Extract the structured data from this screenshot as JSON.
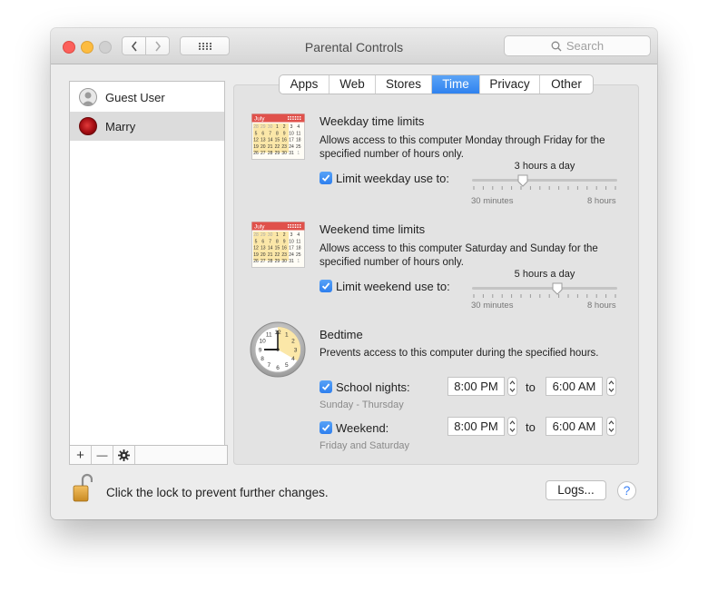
{
  "window": {
    "title": "Parental Controls"
  },
  "toolbar": {
    "search_placeholder": "Search",
    "back_icon": "chevron-left-icon",
    "forward_icon": "chevron-right-icon",
    "grid_icon": "show-all-grid-icon"
  },
  "users": [
    {
      "name": "Guest User",
      "selected": false
    },
    {
      "name": "Marry",
      "selected": true
    }
  ],
  "listbar": {
    "add": "+",
    "remove": "—",
    "gear_icon": "gear-icon"
  },
  "tabs": [
    {
      "label": "Apps",
      "active": false
    },
    {
      "label": "Web",
      "active": false
    },
    {
      "label": "Stores",
      "active": false
    },
    {
      "label": "Time",
      "active": true
    },
    {
      "label": "Privacy",
      "active": false
    },
    {
      "label": "Other",
      "active": false
    }
  ],
  "weekday": {
    "title": "Weekday time limits",
    "description": "Allows access to this computer Monday through Friday for the specified number of hours only.",
    "checkbox_label": "Limit weekday use to:",
    "checked": true,
    "value_label": "3 hours a day",
    "slider_fraction": 0.35,
    "min_label": "30 minutes",
    "max_label": "8 hours",
    "calendar_month": "July"
  },
  "weekend": {
    "title": "Weekend time limits",
    "description": "Allows access to this computer Saturday and Sunday for the specified number of hours only.",
    "checkbox_label": "Limit weekend use to:",
    "checked": true,
    "value_label": "5 hours a day",
    "slider_fraction": 0.59,
    "min_label": "30 minutes",
    "max_label": "8 hours",
    "calendar_month": "July"
  },
  "bedtime": {
    "title": "Bedtime",
    "description": "Prevents access to this computer during the specified hours.",
    "school": {
      "label": "School nights:",
      "checked": true,
      "from": "8:00 PM",
      "to_label": "to",
      "to": "6:00 AM",
      "sub": "Sunday - Thursday"
    },
    "weekend": {
      "label": "Weekend:",
      "checked": true,
      "from": "8:00 PM",
      "to_label": "to",
      "to": "6:00 AM",
      "sub": "Friday and Saturday"
    }
  },
  "calendar_days": [
    "28",
    "29",
    "30",
    "1",
    "2",
    "3",
    "4",
    "5",
    "6",
    "7",
    "8",
    "9",
    "10",
    "11",
    "12",
    "13",
    "14",
    "15",
    "16",
    "17",
    "18",
    "19",
    "20",
    "21",
    "22",
    "23",
    "24",
    "25",
    "26",
    "27",
    "28",
    "29",
    "30",
    "31",
    "1"
  ],
  "clock_numbers": [
    "12",
    "1",
    "2",
    "3",
    "4",
    "5",
    "6",
    "7",
    "8",
    "9",
    "10",
    "11"
  ],
  "footer": {
    "lock_text": "Click the lock to prevent further changes.",
    "logs_label": "Logs...",
    "help_label": "?"
  },
  "colors": {
    "accent": "#3b88f2",
    "calendar_header": "#e0514b",
    "calendar_highlight": "#fbe7a8"
  }
}
